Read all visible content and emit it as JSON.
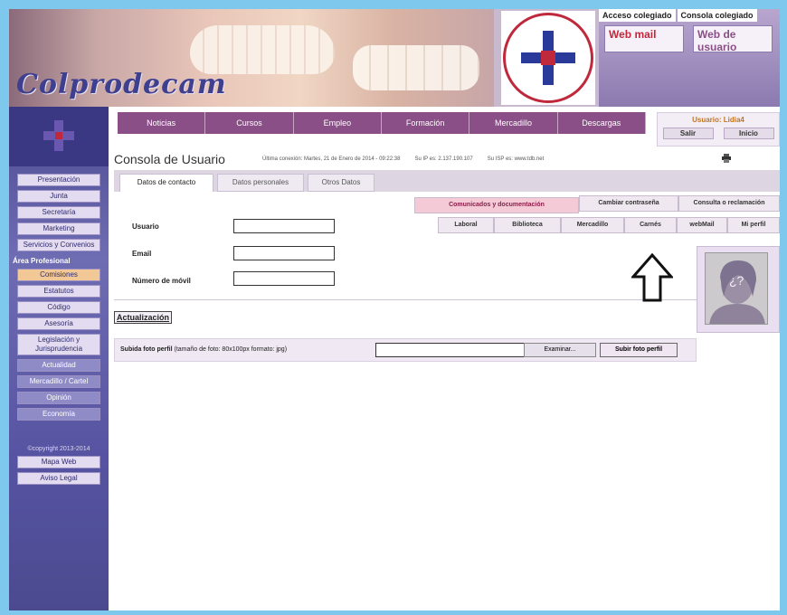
{
  "brand": "Colprodecam",
  "header": {
    "links": [
      "Acceso colegiado",
      "Consola colegiado"
    ],
    "webmail_label": "Web mail",
    "webmail2_label": "Web de usuario"
  },
  "sidebar": {
    "items": [
      {
        "label": "Presentación"
      },
      {
        "label": "Junta"
      },
      {
        "label": "Secretaría"
      },
      {
        "label": "Marketing"
      },
      {
        "label": "Servicios y Convenios"
      }
    ],
    "section_title": "Área Profesional",
    "pro_items": [
      {
        "label": "Comisiones",
        "active": true
      },
      {
        "label": "Estatutos"
      },
      {
        "label": "Código"
      },
      {
        "label": "Asesoría"
      },
      {
        "label": "Legislación y Jurisprudencia"
      },
      {
        "label": "Actualidad"
      },
      {
        "label": "Mercadillo / Cartel"
      },
      {
        "label": "Opinión"
      },
      {
        "label": "Economía"
      }
    ],
    "copyright": "©copyright 2013-2014",
    "footer_items": [
      {
        "label": "Mapa Web"
      },
      {
        "label": "Aviso Legal"
      }
    ]
  },
  "topnav": [
    "Noticias",
    "Cursos",
    "Empleo",
    "Formación",
    "Mercadillo",
    "Descargas"
  ],
  "user_box": {
    "name": "Usuario: Lidia4",
    "logout": "Salir",
    "home": "Inicio"
  },
  "page": {
    "title": "Consola de Usuario",
    "meta": [
      "Última conexión: Martes, 21 de Enero de 2014 - 09:22:38",
      "Su IP es: 2.137.190.107",
      "Su ISP es: www.tdb.net"
    ]
  },
  "tabs": [
    "Datos de contacto",
    "Datos personales",
    "Otros Datos"
  ],
  "form": {
    "usuario_label": "Usuario",
    "email_label": "Email",
    "movil_label": "Número de móvil",
    "usuario_value": "",
    "email_value": "",
    "movil_value": ""
  },
  "right_tabs_row1": [
    "Comunicados y documentación",
    "Cambiar contraseña",
    "Consulta o reclamación"
  ],
  "right_tabs_row2": [
    "Laboral",
    "Biblioteca",
    "Mercadillo",
    "Carnés",
    "webMail",
    "Mi perfil"
  ],
  "update_section": "Actualización",
  "upload": {
    "label_bold": "Subida foto perfil",
    "label_rest": "(tamaño de foto: 80x100px  formato: jpg)",
    "browse": "Examinar...",
    "submit": "Subir foto perfil"
  },
  "profile_placeholder": "¿?",
  "colors": {
    "nav_bg": "#8a4f86",
    "sidebar_bg": "#5654a2",
    "frame_border": "#7dc8ec",
    "accent_red": "#c0283c"
  }
}
